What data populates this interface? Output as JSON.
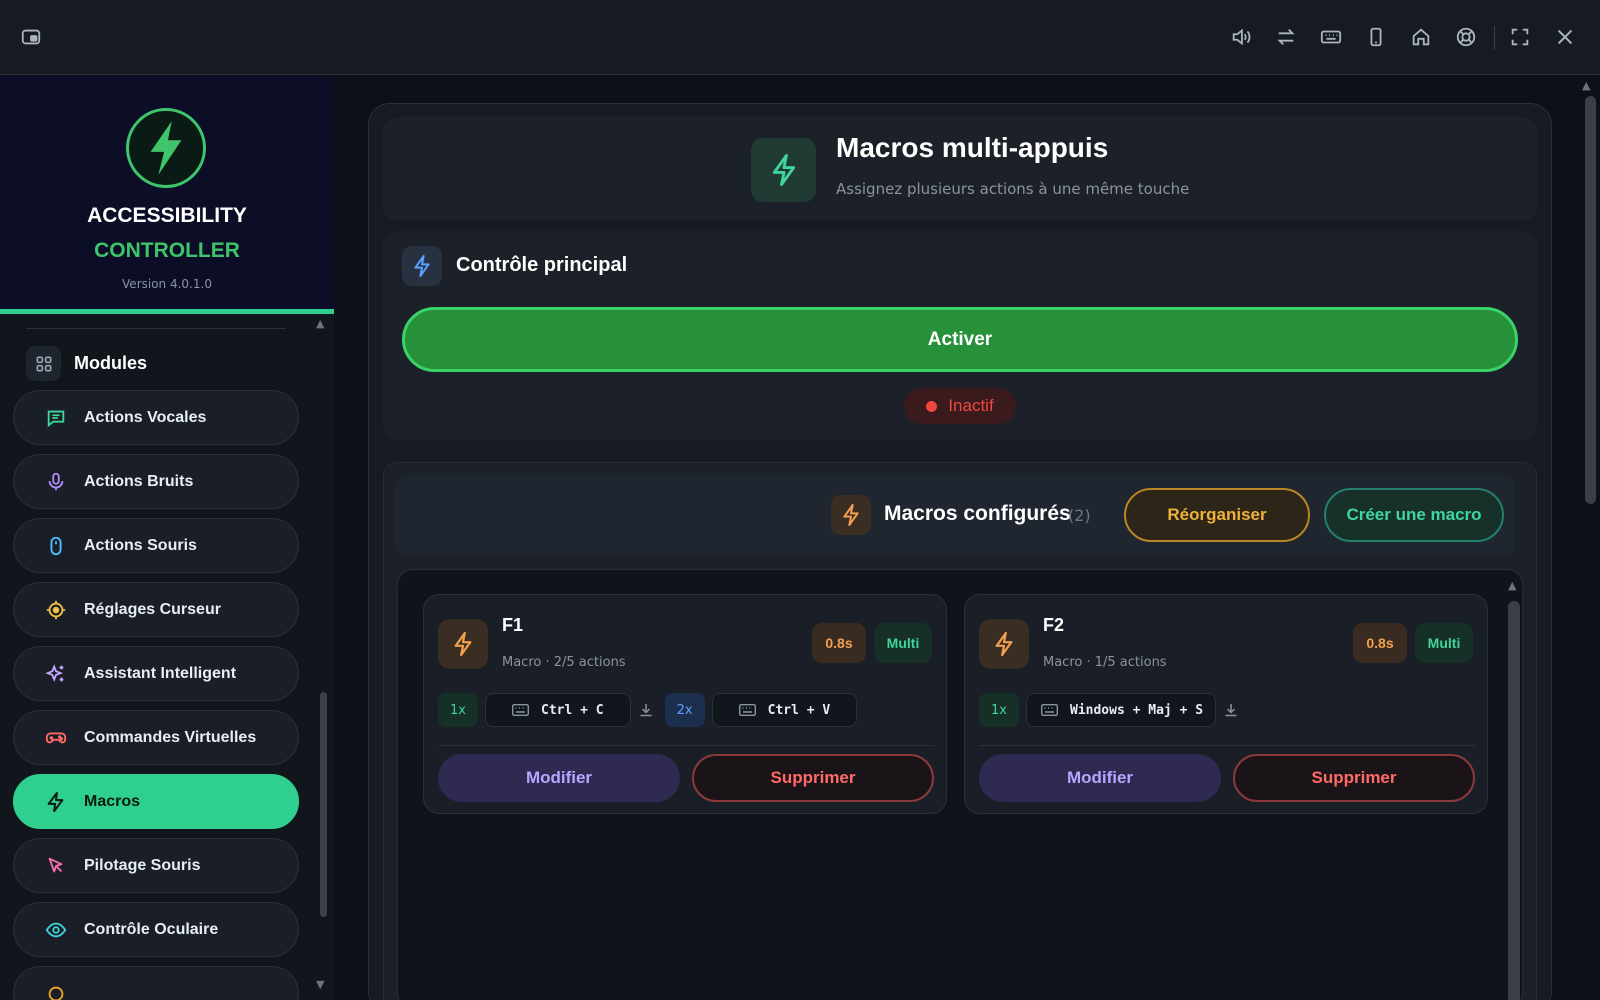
{
  "titlebar": {
    "icons": [
      "picture-in-picture-icon",
      "volume-icon",
      "swap-icon",
      "keyboard-icon",
      "phone-icon",
      "home-icon",
      "lifebuoy-icon",
      "fullscreen-icon",
      "close-icon"
    ]
  },
  "brand": {
    "line1": "ACCESSIBILITY",
    "line2": "CONTROLLER",
    "version": "Version 4.0.1.0",
    "accent": "#3ec46b"
  },
  "sidebar": {
    "section_title": "Modules",
    "items": [
      {
        "label": "Actions Vocales",
        "icon": "chat-icon",
        "color": "#3fd49a"
      },
      {
        "label": "Actions Bruits",
        "icon": "microphone-icon",
        "color": "#b48cff"
      },
      {
        "label": "Actions Souris",
        "icon": "mouse-icon",
        "color": "#4cc3ff"
      },
      {
        "label": "Réglages Curseur",
        "icon": "target-icon",
        "color": "#f5c242"
      },
      {
        "label": "Assistant Intelligent",
        "icon": "sparkles-icon",
        "color": "#c9a6ff"
      },
      {
        "label": "Commandes Virtuelles",
        "icon": "gamepad-icon",
        "color": "#ff6a66"
      },
      {
        "label": "Macros",
        "icon": "bolt-icon",
        "color": "#0b1a12",
        "active": true
      },
      {
        "label": "Pilotage Souris",
        "icon": "cursor-icon",
        "color": "#ff6fb0"
      },
      {
        "label": "Contrôle Oculaire",
        "icon": "eye-icon",
        "color": "#3ed0d8"
      }
    ]
  },
  "header": {
    "title": "Macros multi-appuis",
    "subtitle": "Assignez plusieurs actions à une même touche"
  },
  "control": {
    "title": "Contrôle principal",
    "activate_label": "Activer",
    "status": "Inactif",
    "status_color": "#f0483e"
  },
  "macros": {
    "title": "Macros configurés",
    "count": "(2)",
    "reorganize_label": "Réorganiser",
    "create_label": "Créer une macro",
    "items": [
      {
        "key": "F1",
        "subtitle": "Macro · 2/5 actions",
        "delay": "0.8s",
        "mode": "Multi",
        "actions": [
          {
            "count": "1x",
            "combo": "Ctrl + C"
          },
          {
            "count": "2x",
            "combo": "Ctrl + V"
          }
        ],
        "edit_label": "Modifier",
        "delete_label": "Supprimer"
      },
      {
        "key": "F2",
        "subtitle": "Macro · 1/5 actions",
        "delay": "0.8s",
        "mode": "Multi",
        "actions": [
          {
            "count": "1x",
            "combo": "Windows + Maj + S"
          }
        ],
        "edit_label": "Modifier",
        "delete_label": "Supprimer"
      }
    ]
  }
}
